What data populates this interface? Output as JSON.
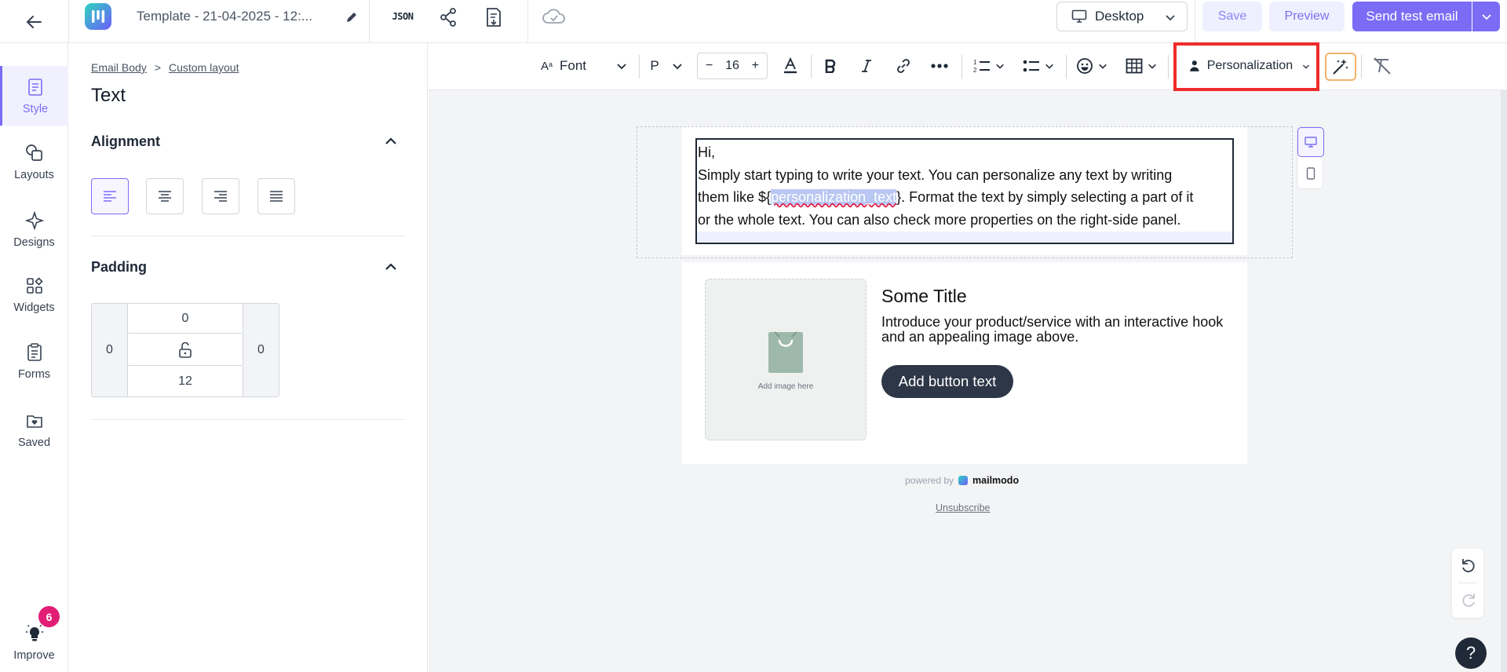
{
  "topbar": {
    "template_name": "Template - 21-04-2025 - 12:...",
    "json_label": "JSON",
    "device_label": "Desktop",
    "save_label": "Save",
    "preview_label": "Preview",
    "send_test_label": "Send test email"
  },
  "leftnav": {
    "items": [
      {
        "label": "Style",
        "icon": "style-icon"
      },
      {
        "label": "Layouts",
        "icon": "layouts-icon"
      },
      {
        "label": "Designs",
        "icon": "designs-icon"
      },
      {
        "label": "Widgets",
        "icon": "widgets-icon"
      },
      {
        "label": "Forms",
        "icon": "forms-icon"
      },
      {
        "label": "Saved",
        "icon": "saved-icon"
      }
    ],
    "improve_label": "Improve",
    "improve_badge": "6"
  },
  "panel": {
    "breadcrumb": [
      "Email Body",
      "Custom layout"
    ],
    "breadcrumb_sep": ">",
    "title": "Text",
    "alignment_label": "Alignment",
    "padding_label": "Padding",
    "padding": {
      "top": "0",
      "right": "0",
      "bottom": "12",
      "left": "0"
    }
  },
  "toolbar": {
    "font_label": "Font",
    "paragraph_label": "P",
    "font_size": "16",
    "minus": "−",
    "plus": "+",
    "personalization_label": "Personalization"
  },
  "email": {
    "text_line1": "Hi,",
    "text_line2": "Simply start typing to write your text. You can personalize any text by writing",
    "text_line3_a": "them like ${",
    "text_line3_highlight": "personalization_text",
    "text_line3_b": "}. Format the text by simply selecting a part of it",
    "text_line4": "or the whole text. You can also check more properties on the right-side panel.",
    "image_placeholder": "Add image here",
    "card_title": "Some Title",
    "card_description": "Introduce your product/service with an interactive hook and an appealing image above.",
    "card_button": "Add button text",
    "powered_by": "powered by",
    "brand": "mailmodo",
    "unsubscribe": "Unsubscribe"
  },
  "help_label": "?",
  "colors": {
    "accent": "#7b6cf6",
    "highlight_box": "#ef2b2b",
    "badge": "#e11d74"
  }
}
